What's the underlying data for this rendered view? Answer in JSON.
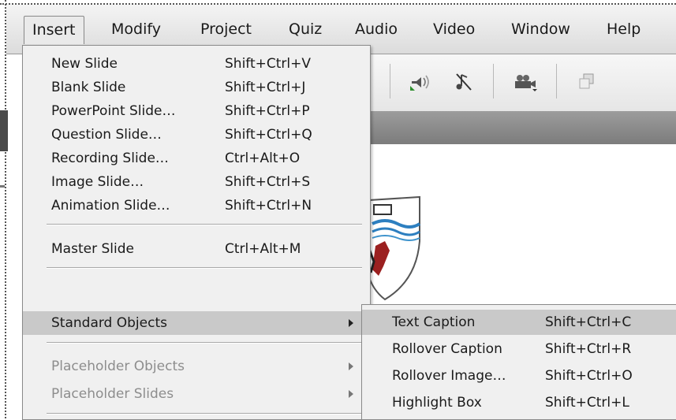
{
  "menubar": {
    "items": [
      {
        "label": "Insert"
      },
      {
        "label": "Modify"
      },
      {
        "label": "Project"
      },
      {
        "label": "Quiz"
      },
      {
        "label": "Audio"
      },
      {
        "label": "Video"
      },
      {
        "label": "Window"
      },
      {
        "label": "Help"
      }
    ]
  },
  "toolbar": {
    "icons": [
      "audio-record-icon",
      "audio-mute-icon",
      "camera-capture-icon",
      "copy-slide-icon"
    ]
  },
  "insert_menu": {
    "items": [
      {
        "label": "New Slide",
        "shortcut": "Shift+Ctrl+V"
      },
      {
        "label": "Blank Slide",
        "shortcut": "Shift+Ctrl+J"
      },
      {
        "label": "PowerPoint Slide…",
        "shortcut": "Shift+Ctrl+P"
      },
      {
        "label": "Question Slide…",
        "shortcut": "Shift+Ctrl+Q"
      },
      {
        "label": "Recording Slide…",
        "shortcut": "Ctrl+Alt+O"
      },
      {
        "label": "Image Slide…",
        "shortcut": "Shift+Ctrl+S"
      },
      {
        "label": "Animation Slide…",
        "shortcut": "Shift+Ctrl+N"
      },
      {
        "label": "Master Slide",
        "shortcut": "Ctrl+Alt+M"
      },
      {
        "label": "Standard Objects"
      },
      {
        "label": "Placeholder Objects"
      },
      {
        "label": "Placeholder Slides"
      }
    ]
  },
  "standard_objects_submenu": {
    "items": [
      {
        "label": "Text Caption",
        "shortcut": "Shift+Ctrl+C"
      },
      {
        "label": "Rollover Caption",
        "shortcut": "Shift+Ctrl+R"
      },
      {
        "label": "Rollover Image…",
        "shortcut": "Shift+Ctrl+O"
      },
      {
        "label": "Highlight Box",
        "shortcut": "Shift+Ctrl+L"
      }
    ]
  },
  "colors": {
    "menu_bg": "#f0f0f0",
    "highlight": "#c9c9c9",
    "disabled_text": "#8d8d8d"
  }
}
